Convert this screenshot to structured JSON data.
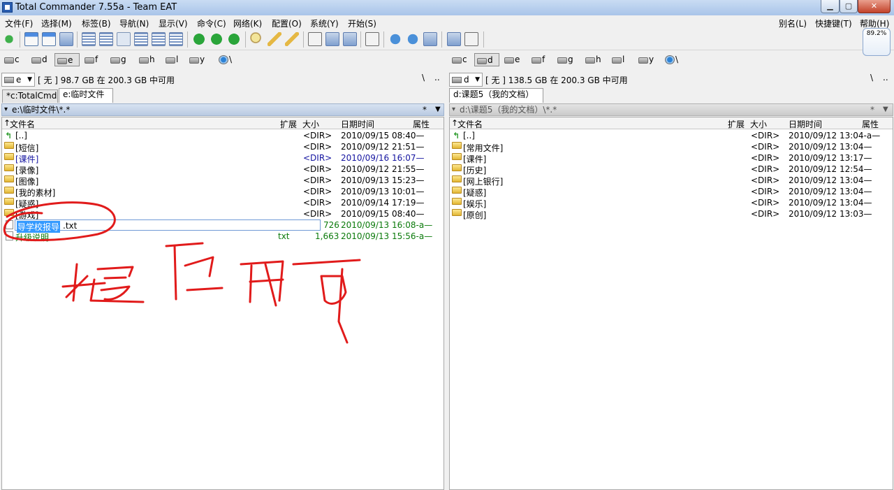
{
  "window": {
    "title": "Total Commander 7.55a - Team EAT"
  },
  "menu": {
    "left": [
      "文件(F)",
      "选择(M)",
      "标签(B)",
      "导航(N)",
      "显示(V)",
      "命令(C)",
      "网络(K)",
      "配置(O)",
      "系统(Y)",
      "开始(S)"
    ],
    "right": [
      "别名(L)",
      "快捷键(T)",
      "帮助(H)"
    ]
  },
  "zoom_widget": "89.2%",
  "left_panel": {
    "drives": [
      "c",
      "d",
      "e",
      "f",
      "g",
      "h",
      "l",
      "y",
      "\\"
    ],
    "active_drive": "e",
    "drive_select": "e",
    "free_space": "[ 无 ]  98.7 GB 在 200.3 GB 中可用",
    "root": "\\",
    "up": "..",
    "tabs": [
      "*c:TotalCmd",
      "e:临时文件"
    ],
    "active_tab": "e:临时文件",
    "path": "e:\\临时文件\\*.*",
    "path_star": "*",
    "headers": {
      "name": "文件名",
      "ext": "扩展",
      "size": "大小",
      "date": "日期时间",
      "attr": "属性"
    },
    "rows": [
      {
        "name": "[..]",
        "ext": "",
        "size": "<DIR>",
        "date": "2010/09/15 08:40—",
        "type": "up"
      },
      {
        "name": "[短信]",
        "ext": "",
        "size": "<DIR>",
        "date": "2010/09/12 21:51—",
        "type": "folder"
      },
      {
        "name": "[课件]",
        "ext": "",
        "size": "<DIR>",
        "date": "2010/09/16 16:07—",
        "type": "folder",
        "style": "blue"
      },
      {
        "name": "[录像]",
        "ext": "",
        "size": "<DIR>",
        "date": "2010/09/12 21:55—",
        "type": "folder"
      },
      {
        "name": "[图像]",
        "ext": "",
        "size": "<DIR>",
        "date": "2010/09/13 15:23—",
        "type": "folder"
      },
      {
        "name": "[我的素材]",
        "ext": "",
        "size": "<DIR>",
        "date": "2010/09/13 10:01—",
        "type": "folder"
      },
      {
        "name": "[疑惑]",
        "ext": "",
        "size": "<DIR>",
        "date": "2010/09/14 17:19—",
        "type": "folder"
      },
      {
        "name": "[游戏]",
        "ext": "",
        "size": "<DIR>",
        "date": "2010/09/15 08:40—",
        "type": "folder"
      },
      {
        "name": "导学校报导",
        "ext": ".txt",
        "size": "726",
        "date": "2010/09/13 16:08-a—",
        "type": "rename",
        "style": "green"
      },
      {
        "name": "升级说明",
        "ext": "txt",
        "size": "1,663",
        "date": "2010/09/13 15:56-a—",
        "type": "file",
        "style": "green"
      }
    ]
  },
  "right_panel": {
    "drives": [
      "c",
      "d",
      "e",
      "f",
      "g",
      "h",
      "l",
      "y",
      "\\"
    ],
    "active_drive": "d",
    "drive_select": "d",
    "free_space": "[ 无 ]  138.5 GB 在 200.3 GB 中可用",
    "root": "\\",
    "up": "..",
    "tabs": [
      "d:课题5（我的文档）"
    ],
    "active_tab": "d:课题5（我的文档）",
    "path": "d:\\课题5（我的文档）\\*.*",
    "path_star": "*",
    "headers": {
      "name": "文件名",
      "ext": "扩展",
      "size": "大小",
      "date": "日期时间",
      "attr": "属性"
    },
    "rows": [
      {
        "name": "[..]",
        "size": "<DIR>",
        "date": "2010/09/12 13:04-a—",
        "type": "up"
      },
      {
        "name": "[常用文件]",
        "size": "<DIR>",
        "date": "2010/09/12 13:04—",
        "type": "folder"
      },
      {
        "name": "[课件]",
        "size": "<DIR>",
        "date": "2010/09/12 13:17—",
        "type": "folder"
      },
      {
        "name": "[历史]",
        "size": "<DIR>",
        "date": "2010/09/12 12:54—",
        "type": "folder"
      },
      {
        "name": "[网上银行]",
        "size": "<DIR>",
        "date": "2010/09/12 13:04—",
        "type": "folder"
      },
      {
        "name": "[疑惑]",
        "size": "<DIR>",
        "date": "2010/09/12 13:04—",
        "type": "folder"
      },
      {
        "name": "[娱乐]",
        "size": "<DIR>",
        "date": "2010/09/12 13:04—",
        "type": "folder"
      },
      {
        "name": "[原创]",
        "size": "<DIR>",
        "date": "2010/09/12 13:03—",
        "type": "folder"
      }
    ]
  },
  "annotation": {
    "handwriting": "拖下即可",
    "color": "#e11b1b"
  },
  "colors": {
    "blue_text": "#1414a0",
    "green_text": "#0b7a0b",
    "selection": "#3399ff"
  }
}
